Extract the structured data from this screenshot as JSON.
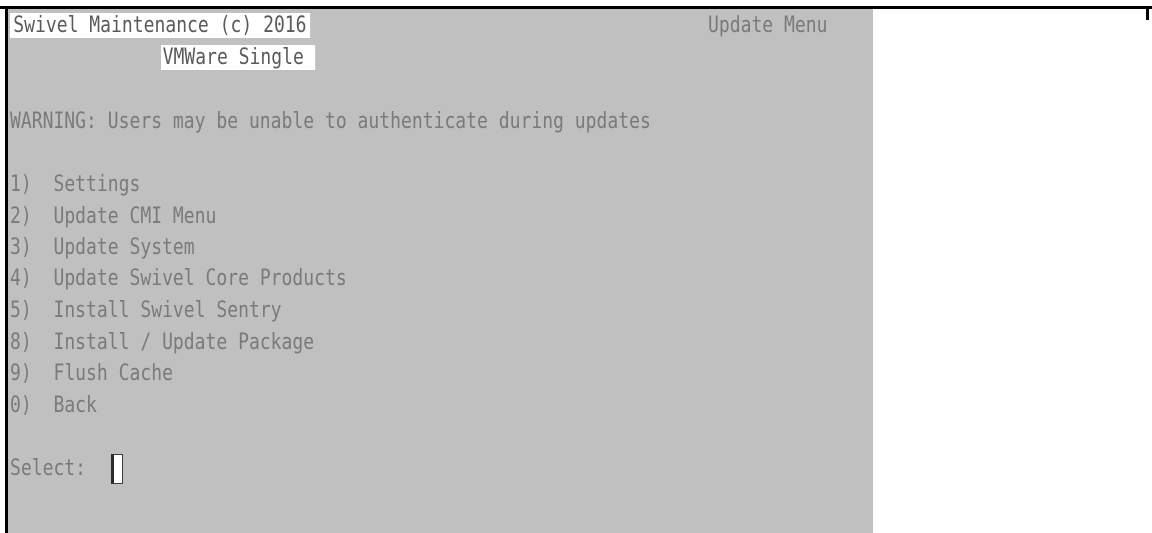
{
  "header": {
    "title": "Swivel Maintenance (c) 2016",
    "menu_name": "Update Menu",
    "subtitle": "VMWare Single"
  },
  "warning": "WARNING: Users may be unable to authenticate during updates",
  "menu": {
    "items": [
      {
        "key": "1)",
        "label": "Settings"
      },
      {
        "key": "2)",
        "label": "Update CMI Menu"
      },
      {
        "key": "3)",
        "label": "Update System"
      },
      {
        "key": "4)",
        "label": "Update Swivel Core Products"
      },
      {
        "key": "5)",
        "label": "Install Swivel Sentry"
      },
      {
        "key": "8)",
        "label": "Install / Update Package"
      },
      {
        "key": "9)",
        "label": "Flush Cache"
      },
      {
        "key": "0)",
        "label": "Back"
      }
    ]
  },
  "prompt": {
    "label": "Select:",
    "value": ""
  },
  "colors": {
    "background": "#c0c0c0",
    "text": "#7a7a7a",
    "highlight": "#ffffff"
  }
}
